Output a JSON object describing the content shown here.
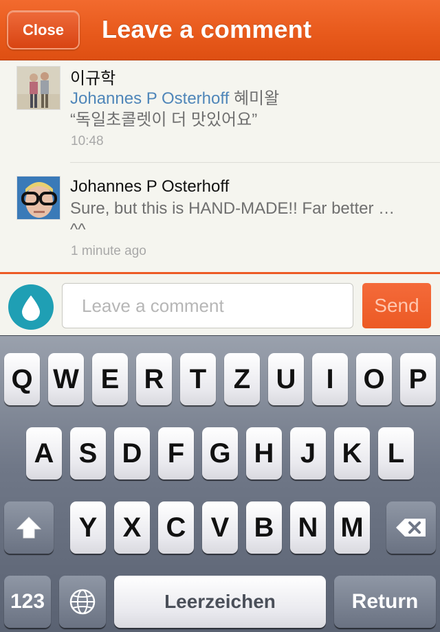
{
  "header": {
    "close_label": "Close",
    "title": "Leave a comment"
  },
  "comments": [
    {
      "author": "이규학",
      "mention": "Johannes P Osterhoff",
      "body_suffix": " 혜미왈",
      "body_line2": "“독일초콜렛이 더 맛있어요”",
      "time": "10:48"
    },
    {
      "author": "Johannes P Osterhoff",
      "body_line1": "Sure, but this is HAND-MADE!! Far better …",
      "body_line2": "^^",
      "time": "1 minute ago"
    }
  ],
  "input_bar": {
    "placeholder": "Leave a comment",
    "send_label": "Send",
    "drop_icon": "water-drop-icon",
    "accent_color": "#ec5a24",
    "drop_color": "#1f9fb4"
  },
  "keyboard": {
    "row1": [
      "Q",
      "W",
      "E",
      "R",
      "T",
      "Z",
      "U",
      "I",
      "O",
      "P"
    ],
    "row2": [
      "A",
      "S",
      "D",
      "F",
      "G",
      "H",
      "J",
      "K",
      "L"
    ],
    "row3": [
      "Y",
      "X",
      "C",
      "V",
      "B",
      "N",
      "M"
    ],
    "numbers_label": "123",
    "space_label": "Leerzeichen",
    "return_label": "Return",
    "shift_icon": "shift-arrow-icon",
    "backspace_icon": "backspace-icon",
    "globe_icon": "globe-icon"
  }
}
